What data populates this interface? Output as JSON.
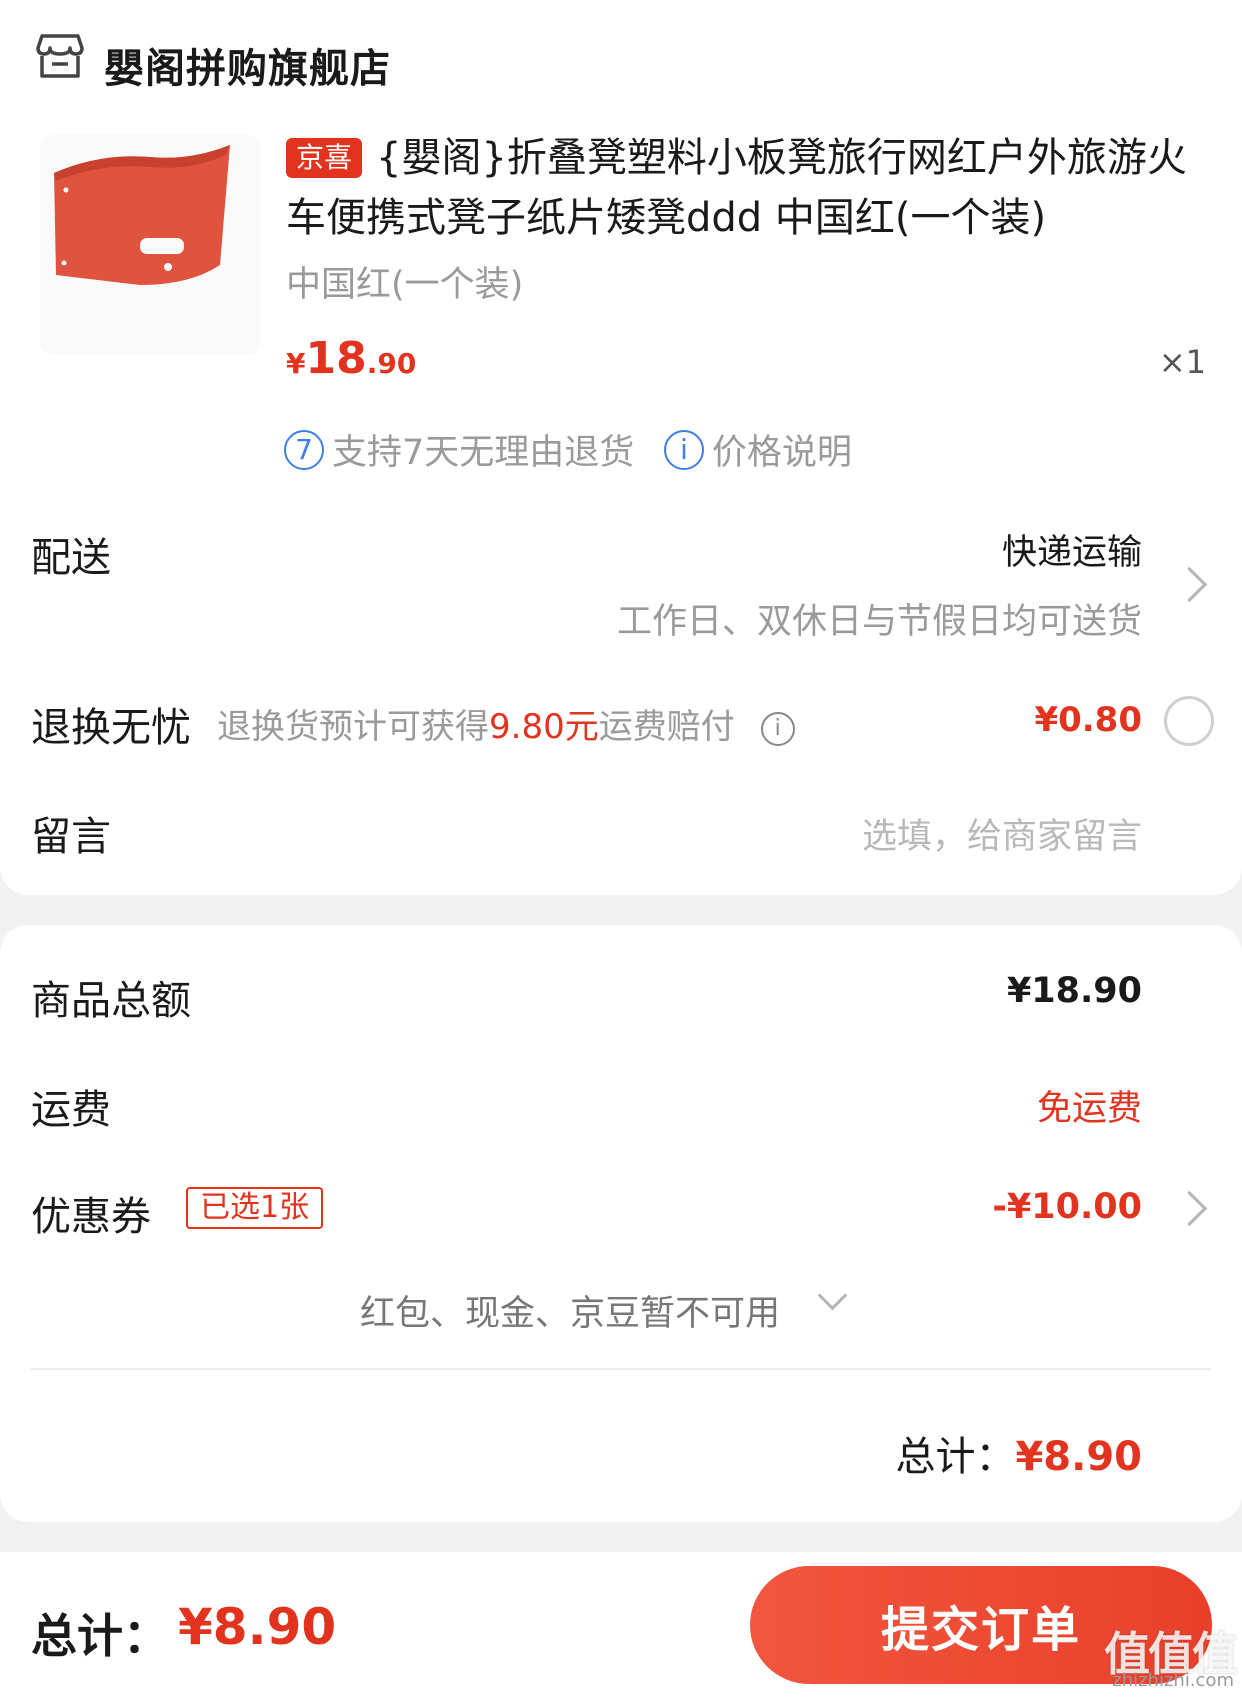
{
  "store": {
    "name": "嬰阁拼购旗舰店",
    "icon": "store-icon"
  },
  "product": {
    "badge": "京喜",
    "title": "{嬰阁}折叠凳塑料小板凳旅行网红户外旅游火车便携式凳子纸片矮凳ddd 中国红(一个装)",
    "spec": "中国红(一个装)",
    "price_symbol": "¥",
    "price_int": "18",
    "price_dec": ".90",
    "quantity": "×1",
    "services": [
      {
        "icon": "seven-day-icon",
        "icon_text": "7",
        "label": "支持7天无理由退货"
      },
      {
        "icon": "info-icon",
        "icon_text": "i",
        "label": "价格说明"
      }
    ]
  },
  "delivery": {
    "label": "配送",
    "method": "快递运输",
    "note": "工作日、双休日与节假日均可送货"
  },
  "return_insurance": {
    "label": "退换无忧",
    "desc_prefix": "退换货预计可获得",
    "desc_amount": "9.80元",
    "desc_suffix": "运费赔付",
    "price": "¥0.80",
    "selected": false
  },
  "message": {
    "label": "留言",
    "placeholder": "选填，给商家留言"
  },
  "summary": {
    "goods_label": "商品总额",
    "goods_value": "¥18.90",
    "shipping_label": "运费",
    "shipping_value": "免运费",
    "coupon_label": "优惠券",
    "coupon_tag": "已选1张",
    "coupon_value": "-¥10.00",
    "unavailable": "红包、现金、京豆暂不可用",
    "total_label": "总计：",
    "total_value": "¥8.90"
  },
  "bottom": {
    "total_label": "总计：",
    "total_value": "¥8.90",
    "submit_label": "提交订单",
    "watermark": "值值值",
    "watermark_url": "zhizhizhi.com"
  },
  "colors": {
    "accent": "#e2331e",
    "link_blue": "#3d7fe6",
    "button_gradient_start": "#f2563e",
    "button_gradient_end": "#e8402a"
  }
}
